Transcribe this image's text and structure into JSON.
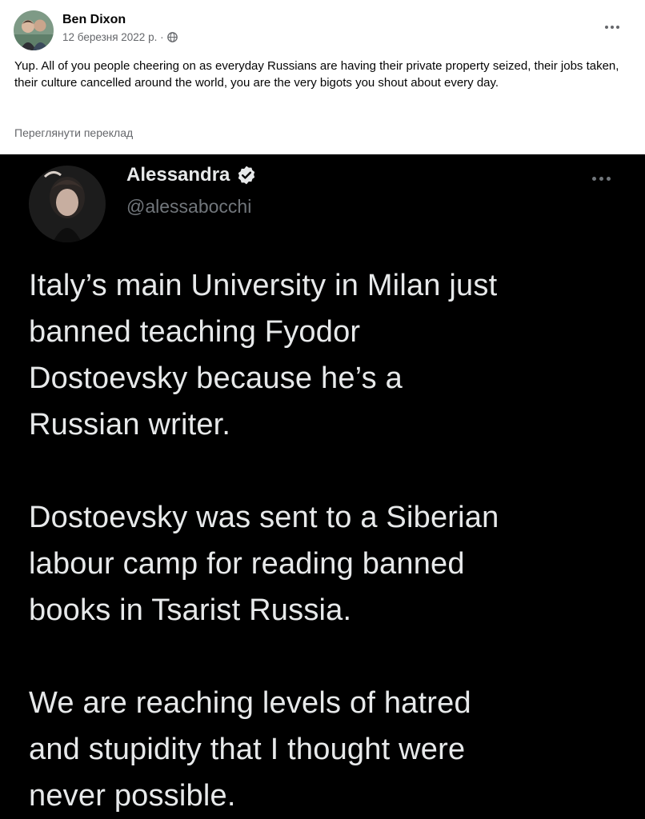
{
  "fb_post": {
    "author": "Ben Dixon",
    "date": "12 березня 2022 р. ·",
    "audience_icon": "globe-icon",
    "text": "Yup. All of you people cheering on as everyday Russians are having their private property seized, their jobs taken, their culture cancelled around the world, you are the very bigots you shout about every day.",
    "translate_label": "Переглянути переклад"
  },
  "tweet": {
    "name": "Alessandra",
    "handle": "@alessabocchi",
    "verified_icon": "verified-badge-icon",
    "paragraphs": [
      [
        "Italy’s main University in Milan just",
        "banned teaching Fyodor",
        "Dostoevsky because he’s a",
        "Russian writer."
      ],
      [
        "Dostoevsky was sent to a Siberian",
        "labour camp for reading banned",
        "books in Tsarist Russia."
      ],
      [
        "We are reaching levels of hatred",
        "and stupidity that I thought were",
        "never possible."
      ]
    ]
  },
  "colors": {
    "fb_text": "#050505",
    "fb_secondary": "#65676b",
    "tweet_bg": "#000000",
    "tweet_text": "#e7e9ea",
    "tweet_handle": "#71767b"
  }
}
